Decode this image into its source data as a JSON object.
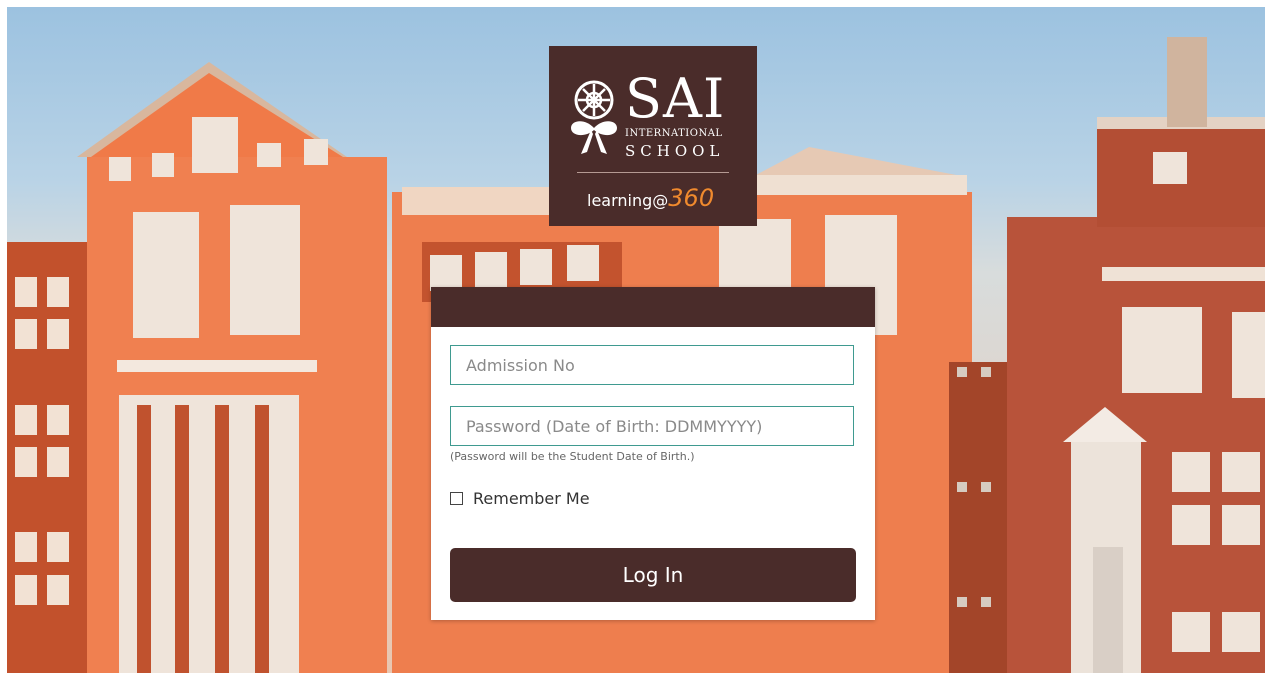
{
  "logo": {
    "brand": "SAI",
    "subtitle": "INTERNATIONAL",
    "school": "SCHOOL",
    "tagline_prefix": "learning@",
    "tagline_suffix": "360"
  },
  "login": {
    "admission_placeholder": "Admission No",
    "admission_value": "",
    "password_placeholder": "Password (Date of Birth: DDMMYYYY)",
    "password_value": "",
    "password_hint": "(Password will be the Student Date of Birth.)",
    "remember_label": "Remember Me",
    "remember_checked": false,
    "submit_label": "Log In"
  },
  "colors": {
    "brand_brown": "#4a2c2a",
    "input_border": "#3f9a90",
    "tagline_accent": "#f08a2e"
  }
}
